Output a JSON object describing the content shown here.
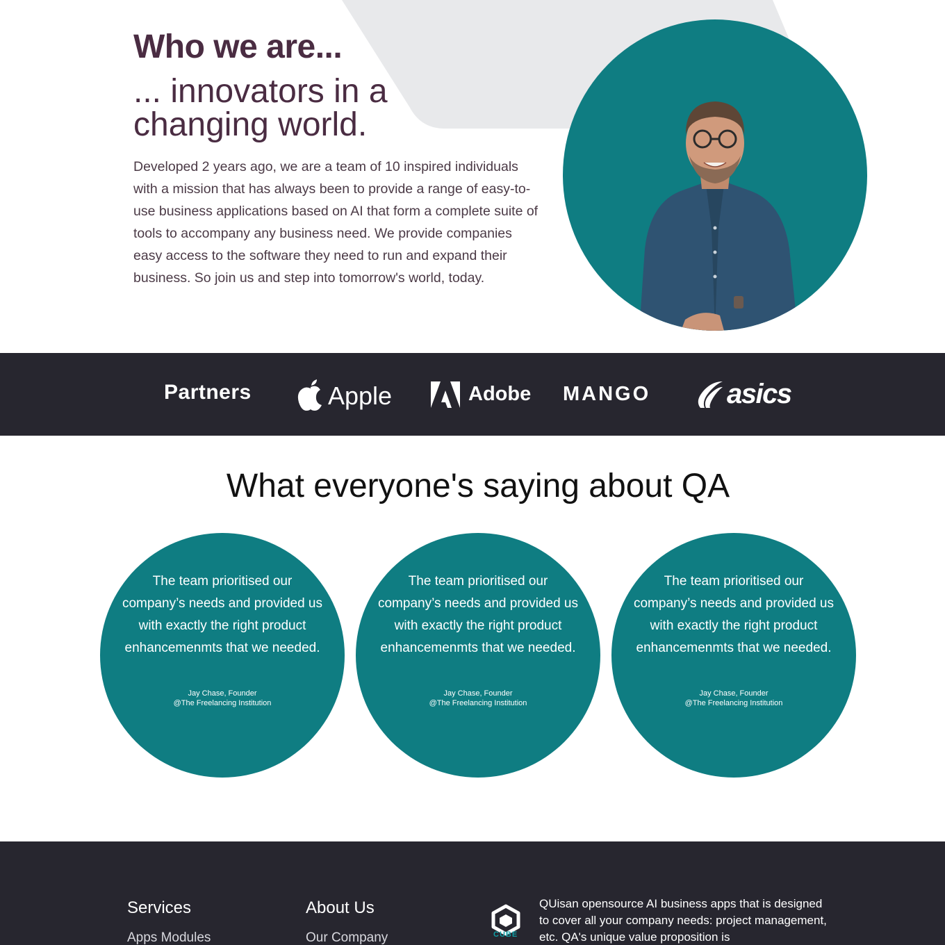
{
  "hero": {
    "title": "Who we are...",
    "subtitle": "... innovators in a changing world.",
    "body": "Developed 2 years ago, we are a team of 10 inspired individuals with a mission that has always been to provide a range of easy-to-use business applications based on AI that form a complete suite of tools to accompany any business need. We provide companies easy access to the software they need to run and expand their business. So join us and step into tomorrow's world, today."
  },
  "partners": {
    "title": "Partners",
    "logos": [
      "Apple",
      "Adobe",
      "MANGO",
      "asics"
    ]
  },
  "testimonials": {
    "title": "What everyone's saying about QA",
    "items": [
      {
        "quote": "The team prioritised our company’s needs and provided us with exactly the right product enhancemenmts that we needed.",
        "author": "Jay Chase, Founder",
        "company": "@The Freelancing Institution"
      },
      {
        "quote": "The team prioritised our company’s needs and provided us with exactly the right product enhancemenmts that we needed.",
        "author": "Jay Chase, Founder",
        "company": "@The Freelancing Institution"
      },
      {
        "quote": "The team prioritised our company’s needs and provided us with exactly the right product enhancemenmts that we needed.",
        "author": "Jay Chase, Founder",
        "company": "@The Freelancing Institution"
      }
    ]
  },
  "footer": {
    "services": {
      "title": "Services",
      "links": [
        "Apps Modules"
      ]
    },
    "about": {
      "title": "About Us",
      "links": [
        "Our Company"
      ]
    },
    "logo_label": "CUBE",
    "description": "QUisan opensource AI business apps that is designed to cover all your company needs: project management, etc. QA's unique value proposition is"
  },
  "colors": {
    "teal": "#0f7d82",
    "dark": "#27262f",
    "plum": "#4a2c42"
  }
}
